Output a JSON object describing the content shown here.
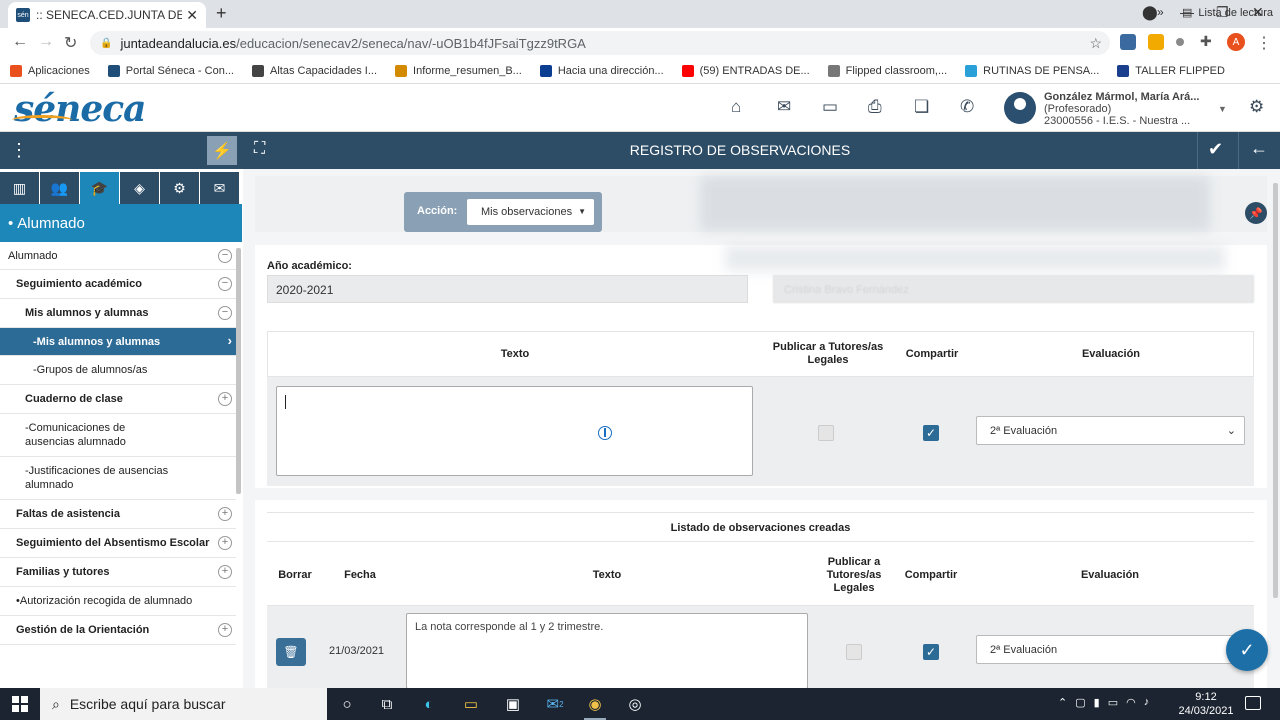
{
  "browser": {
    "tab_title": ":: SENECA.CED.JUNTA DE ANDALUCÍA",
    "favicon_text": "sén",
    "url_host": "juntadeandalucia.es",
    "url_path": "/educacion/senecav2/seneca/nav/-uOB1b4fJFsaiTgzz9tRGA",
    "bookmarks": [
      {
        "label": "Aplicaciones",
        "color": "#e8501e"
      },
      {
        "label": "Portal Séneca - Con...",
        "color": "#1f4e79"
      },
      {
        "label": "Altas Capacidades I...",
        "color": "#444444"
      },
      {
        "label": "Informe_resumen_B...",
        "color": "#d48a00"
      },
      {
        "label": "Hacia una dirección...",
        "color": "#0b3d91"
      },
      {
        "label": "(59) ENTRADAS DE...",
        "color": "#ff0000"
      },
      {
        "label": "Flipped classroom,...",
        "color": "#777777"
      },
      {
        "label": "RUTINAS DE PENSA...",
        "color": "#2aa0d8"
      },
      {
        "label": "TALLER FLIPPED",
        "color": "#1b3f8c"
      }
    ],
    "bookmarks_more": "»",
    "reading_list": "Lista de lectura",
    "profile_initial": "A"
  },
  "header": {
    "logo_text": "séneca",
    "user_name": "González Mármol, María Ará...",
    "user_role": "(Profesorado)",
    "user_center": "23000556 - I.E.S. - Nuestra ..."
  },
  "titlebar": {
    "title": "REGISTRO DE OBSERVACIONES"
  },
  "sidebar": {
    "section_title": "Alumnado",
    "items": [
      {
        "label": "Alumnado",
        "level": 0,
        "bold": false,
        "toggle": "−"
      },
      {
        "label": "Seguimiento académico",
        "level": 1,
        "bold": true,
        "toggle": "−"
      },
      {
        "label": "Mis alumnos y alumnas",
        "level": 2,
        "bold": true,
        "toggle": "−"
      },
      {
        "label": "-Mis alumnos y alumnas",
        "level": 3,
        "bold": true,
        "selected": true
      },
      {
        "label": "-Grupos de alumnos/as",
        "level": 3,
        "bold": false
      },
      {
        "label": "Cuaderno de clase",
        "level": 2,
        "bold": true,
        "toggle": "+"
      },
      {
        "label": "-Comunicaciones de ausencias alumnado",
        "level": 2,
        "bold": false
      },
      {
        "label": "-Justificaciones de ausencias alumnado",
        "level": 2,
        "bold": false
      },
      {
        "label": "Faltas de asistencia",
        "level": 1,
        "bold": true,
        "toggle": "+"
      },
      {
        "label": "Seguimiento del Absentismo Escolar",
        "level": 1,
        "bold": true,
        "toggle": "+"
      },
      {
        "label": "Familias y tutores",
        "level": 1,
        "bold": true,
        "toggle": "+"
      },
      {
        "label": "•Autorización recogida de alumnado",
        "level": 1,
        "bold": false
      },
      {
        "label": "Gestión de la Orientación",
        "level": 1,
        "bold": true,
        "toggle": "+"
      }
    ]
  },
  "action": {
    "label": "Acción:",
    "selected": "Mis observaciones"
  },
  "form": {
    "year_label": "Año académico:",
    "year_value": "2020-2021",
    "blurred_value": "Cristina Bravo Fernández",
    "col_texto": "Texto",
    "col_publicar": "Publicar a Tutores/as Legales",
    "col_compartir": "Compartir",
    "col_evaluacion": "Evaluación",
    "text_value": "",
    "publicar_checked": false,
    "compartir_checked": true,
    "evaluacion_value": "2ª Evaluación"
  },
  "list": {
    "title": "Listado de observaciones creadas",
    "col_borrar": "Borrar",
    "col_fecha": "Fecha",
    "col_texto": "Texto",
    "col_publicar": "Publicar a Tutores/as Legales",
    "col_compartir": "Compartir",
    "col_evaluacion": "Evaluación",
    "rows": [
      {
        "fecha": "21/03/2021",
        "texto": "La nota corresponde al 1 y 2 trimestre.",
        "publicar_checked": false,
        "compartir_checked": true,
        "evaluacion": "2ª Evaluación"
      }
    ]
  },
  "taskbar": {
    "search_placeholder": "Escribe aquí para buscar",
    "mail_badge": "2",
    "time": "9:12",
    "date": "24/03/2021"
  }
}
